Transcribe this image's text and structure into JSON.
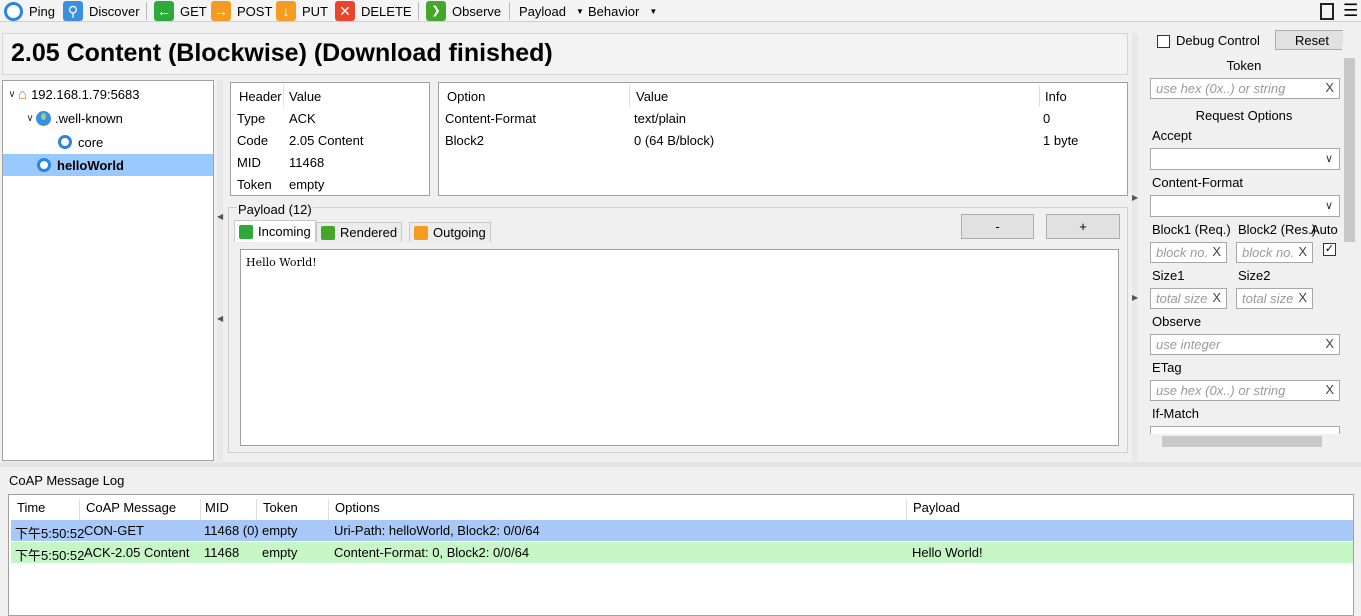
{
  "toolbar": {
    "ping": "Ping",
    "discover": "Discover",
    "get": "GET",
    "post": "POST",
    "put": "PUT",
    "delete": "DELETE",
    "observe": "Observe",
    "payload": "Payload",
    "behavior": "Behavior"
  },
  "title": "2.05 Content (Blockwise) (Download finished)",
  "tree": {
    "host": "192.168.1.79:5683",
    "well_known": ".well-known",
    "core": "core",
    "hello": "helloWorld"
  },
  "header_table": {
    "col_header": "Header",
    "col_value": "Value",
    "rows": [
      {
        "name": "Type",
        "value": "ACK"
      },
      {
        "name": "Code",
        "value": "2.05 Content"
      },
      {
        "name": "MID",
        "value": "11468"
      },
      {
        "name": "Token",
        "value": "empty"
      }
    ]
  },
  "option_table": {
    "col_option": "Option",
    "col_value": "Value",
    "col_info": "Info",
    "rows": [
      {
        "option": "Content-Format",
        "value": "text/plain",
        "info": "0"
      },
      {
        "option": "Block2",
        "value": "0 (64 B/block)",
        "info": "1 byte"
      }
    ]
  },
  "payload": {
    "label": "Payload (12)",
    "tabs": [
      "Incoming",
      "Rendered",
      "Outgoing"
    ],
    "minus": "-",
    "plus": "+",
    "text": "Hello World!"
  },
  "right_panel": {
    "debug_control": "Debug Control",
    "reset": "Reset",
    "token_label": "Token",
    "token_placeholder": "use hex (0x..) or string",
    "request_options": "Request Options",
    "accept": "Accept",
    "content_format": "Content-Format",
    "block1": "Block1 (Req.)",
    "block2": "Block2 (Res.)",
    "auto": "Auto",
    "block_placeholder": "block no.",
    "size1": "Size1",
    "size2": "Size2",
    "size_placeholder": "total size",
    "observe": "Observe",
    "observe_placeholder": "use integer",
    "etag": "ETag",
    "etag_placeholder": "use hex (0x..) or string",
    "if_match": "If-Match",
    "clear": "X"
  },
  "log": {
    "title": "CoAP Message Log",
    "columns": [
      "Time",
      "CoAP Message",
      "MID",
      "Token",
      "Options",
      "Payload"
    ],
    "rows": [
      {
        "time": "下午5:50:52",
        "message": "CON-GET",
        "mid": "11468 (0)",
        "token": "empty",
        "options": "Uri-Path: helloWorld, Block2: 0/0/64",
        "payload": ""
      },
      {
        "time": "下午5:50:52",
        "message": "ACK-2.05 Content",
        "mid": "11468",
        "token": "empty",
        "options": "Content-Format: 0, Block2: 0/0/64",
        "payload": "Hello World!"
      }
    ]
  },
  "colors": {
    "row_request": "#a8c9f7",
    "row_response": "#c6f5c6",
    "tree_selected": "#99c9ff"
  }
}
